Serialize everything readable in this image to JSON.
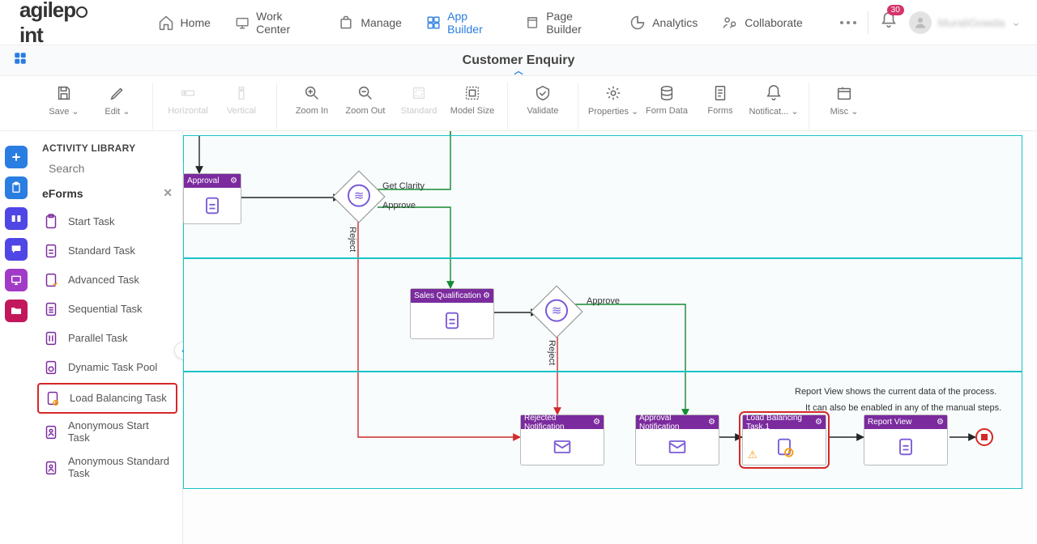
{
  "header": {
    "logo": "agilepoint",
    "nav": [
      "Home",
      "Work Center",
      "Manage",
      "App Builder",
      "Page Builder",
      "Analytics",
      "Collaborate"
    ],
    "active_nav": "App Builder",
    "notif_count": "30",
    "user_name": "MuraliGowda"
  },
  "page_title": "Customer Enquiry",
  "toolbar": {
    "save": "Save",
    "edit": "Edit",
    "horizontal": "Horizontal",
    "vertical": "Vertical",
    "zoom_in": "Zoom In",
    "zoom_out": "Zoom Out",
    "standard": "Standard",
    "model_size": "Model Size",
    "validate": "Validate",
    "properties": "Properties",
    "form_data": "Form Data",
    "forms": "Forms",
    "notificat": "Notificat...",
    "misc": "Misc"
  },
  "library": {
    "title": "ACTIVITY LIBRARY",
    "search_placeholder": "Search",
    "category": "eForms",
    "items": [
      "Start Task",
      "Standard Task",
      "Advanced Task",
      "Sequential Task",
      "Parallel Task",
      "Dynamic Task Pool",
      "Load Balancing Task",
      "Anonymous Start Task",
      "Anonymous Standard Task"
    ],
    "highlight_index": 6
  },
  "canvas": {
    "nodes": {
      "approval": "Approval",
      "sales_q": "Sales Qualification",
      "rejected": "Rejected Notification",
      "approval_notif": "Approval Notification",
      "load_bal": "Load Balancing Task.1",
      "report": "Report View"
    },
    "edges": {
      "get_clarity": "Get Clarity",
      "approve": "Approve",
      "reject": "Reject",
      "approve2": "Approve",
      "reject2": "Reject"
    },
    "notes": {
      "n1": "Report View shows the current data of the process.",
      "n2": "It can also be enabled in any of the manual steps."
    }
  }
}
